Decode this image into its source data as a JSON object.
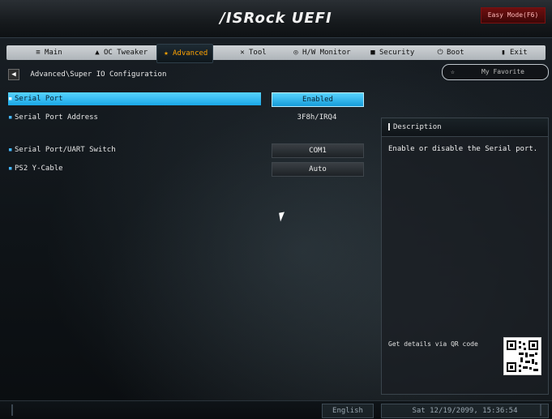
{
  "header": {
    "brand": "/ISRock UEFI",
    "easy_mode": "Easy Mode(F6)"
  },
  "tabs": [
    {
      "label": "Main",
      "icon": "list-icon"
    },
    {
      "label": "OC Tweaker",
      "icon": "rocket-icon"
    },
    {
      "label": "Advanced",
      "icon": "star-icon",
      "active": true
    },
    {
      "label": "Tool",
      "icon": "tools-icon"
    },
    {
      "label": "H/W Monitor",
      "icon": "monitor-icon"
    },
    {
      "label": "Security",
      "icon": "lock-icon"
    },
    {
      "label": "Boot",
      "icon": "power-icon"
    },
    {
      "label": "Exit",
      "icon": "exit-icon"
    }
  ],
  "breadcrumb": "Advanced\\Super IO Configuration",
  "favorite_label": "My Favorite",
  "settings": [
    {
      "label": "Serial Port",
      "value": "Enabled",
      "selected": true
    },
    {
      "label": "Serial Port Address",
      "value": "3F8h/IRQ4"
    },
    {
      "label": "Serial Port/UART Switch",
      "value": "COM1"
    },
    {
      "label": "PS2 Y-Cable",
      "value": "Auto"
    }
  ],
  "description": {
    "title": "Description",
    "text": "Enable or disable the Serial port.",
    "qr_label": "Get details via QR code"
  },
  "footer": {
    "language": "English",
    "datetime": "Sat 12/19/2099, 15:36:54"
  },
  "colors": {
    "accent_blue": "#1aa7e6",
    "active_tab_text": "#ffa200",
    "easy_mode_red": "#6e0f0f"
  }
}
